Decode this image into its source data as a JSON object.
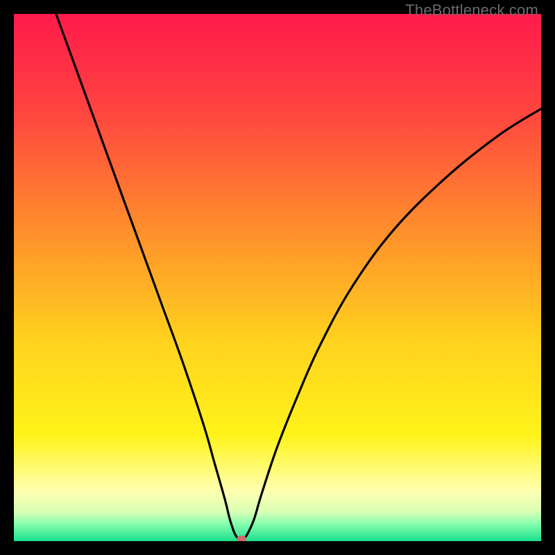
{
  "watermark": "TheBottleneck.com",
  "chart_data": {
    "type": "line",
    "title": "",
    "xlabel": "",
    "ylabel": "",
    "xlim": [
      0,
      100
    ],
    "ylim": [
      0,
      100
    ],
    "grid": false,
    "legend": false,
    "background_gradient_stops": [
      {
        "offset": 0.0,
        "color": "#ff1a4b"
      },
      {
        "offset": 0.18,
        "color": "#ff4340"
      },
      {
        "offset": 0.4,
        "color": "#ff8b2c"
      },
      {
        "offset": 0.62,
        "color": "#ffd21e"
      },
      {
        "offset": 0.8,
        "color": "#fff31a"
      },
      {
        "offset": 0.905,
        "color": "#ffffb0"
      },
      {
        "offset": 0.945,
        "color": "#d7ffb5"
      },
      {
        "offset": 0.965,
        "color": "#8effb0"
      },
      {
        "offset": 1.0,
        "color": "#18e08c"
      }
    ],
    "series": [
      {
        "name": "curve",
        "x": [
          8,
          12,
          16,
          20,
          24,
          28,
          32,
          36,
          38,
          40,
          41,
          42,
          42.8,
          43.5,
          44.2,
          45.5,
          47,
          50,
          54,
          58,
          64,
          72,
          82,
          92,
          100
        ],
        "y": [
          100,
          89,
          78,
          67,
          56,
          45,
          34,
          22,
          15,
          8,
          4,
          1.2,
          0.5,
          0.5,
          1.2,
          4,
          9,
          18,
          28,
          37,
          48,
          59,
          69,
          77,
          82
        ]
      }
    ],
    "marker": {
      "x": 43.2,
      "y": 0.4,
      "color": "#cf6a6a",
      "rx": 7,
      "ry": 5
    }
  }
}
